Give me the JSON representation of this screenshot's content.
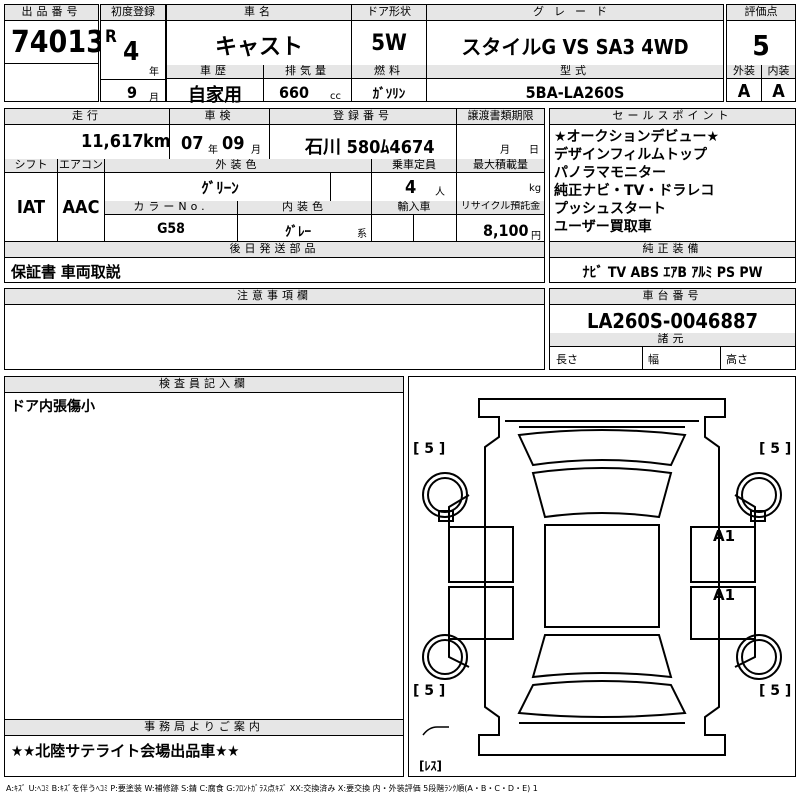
{
  "headers": {
    "lot_no": "出品番号",
    "first_reg": "初度登録",
    "car_name": "車名",
    "door_type": "ドア形状",
    "grade": "グレード",
    "score": "評価点",
    "history": "車歴",
    "displacement": "排気量",
    "fuel": "燃料",
    "model_code": "型式",
    "exterior": "外装",
    "interior": "内装",
    "mileage": "走行",
    "inspection": "車検",
    "plate": "登録番号",
    "transfer_doc": "譲渡書類期限",
    "sales_points": "セールスポイント",
    "shift": "シフト",
    "aircon": "エアコン",
    "ext_color": "外装色",
    "capacity": "乗車定員",
    "max_load": "最大積載量",
    "color_no": "カラーNo.",
    "int_color": "内装色",
    "import": "輸入車",
    "recycle": "リサイクル預託金",
    "later_parts": "後日発送部品",
    "genuine_equip": "純正装備",
    "notes": "注意事項欄",
    "chassis_no": "車台番号",
    "dims": "諸元",
    "inspector": "検査員記入欄",
    "office_notice": "事務局よりご案内"
  },
  "lot_no": "74013",
  "first_reg": {
    "era": "R",
    "year": "4",
    "year_unit": "年",
    "month": "9",
    "month_unit": "月"
  },
  "car_name": "キャスト",
  "door_type": "5W",
  "grade": "スタイルG VS SA3 4WD",
  "score": "5",
  "history": "自家用",
  "displacement": "660",
  "displacement_unit": "cc",
  "fuel": "ｶﾞｿﾘﾝ",
  "model_code": "5BA-LA260S",
  "exterior_score": "A",
  "interior_score": "A",
  "mileage": "11,617",
  "mileage_unit": "km",
  "inspection": {
    "year": "07",
    "year_unit": "年",
    "month": "09",
    "month_unit": "月"
  },
  "plate": "石川 580ﾑ4674",
  "transfer_doc": {
    "month_unit": "月",
    "day_unit": "日"
  },
  "sales_points": [
    "★オークションデビュー★",
    "デザインフィルムトップ",
    "パノラマモニター",
    "純正ナビ・TV・ドラレコ",
    "プッシュスタート",
    "ユーザー買取車"
  ],
  "shift": "IAT",
  "aircon": "AAC",
  "ext_color": "ｸﾞﾘｰﾝ",
  "capacity": "4",
  "capacity_unit": "人",
  "load_unit": "kg",
  "color_no": "G58",
  "int_color": "ｸﾞﾚｰ",
  "int_color_suffix": "系",
  "recycle": "8,100",
  "recycle_unit": "円",
  "later_parts": "保証書 車両取説",
  "genuine_equip": "ﾅﾋﾞ TV ABS ｴｱB ｱﾙﾐ PS PW",
  "chassis_no": "LA260S-0046887",
  "dims": {
    "length": "長さ",
    "width": "幅",
    "height": "高さ"
  },
  "inspector_note": "ドア内張傷小",
  "office_notice": "★★北陸サテライト会場出品車★★",
  "diagram_marks": {
    "front_left": "[ 5 ]",
    "front_right": "[ 5 ]",
    "rear_left": "[ 5 ]",
    "rear_right": "[ 5 ]",
    "spare": "[ﾚｽ]",
    "door_front_right": "A1",
    "door_rear_right": "A1"
  },
  "legend": "A:ｷｽﾞ U:ﾍｺﾐ B:ｷｽﾞを伴うﾍｺﾐ P:要塗装 W:補修跡 S:錆 C:腐食 G:ﾌﾛﾝﾄｶﾞﾗｽ点ｷｽﾞ XX:交換済み X:要交換 内・外装評価 5段階ﾗﾝｸ順(A・B・C・D・E) 1"
}
